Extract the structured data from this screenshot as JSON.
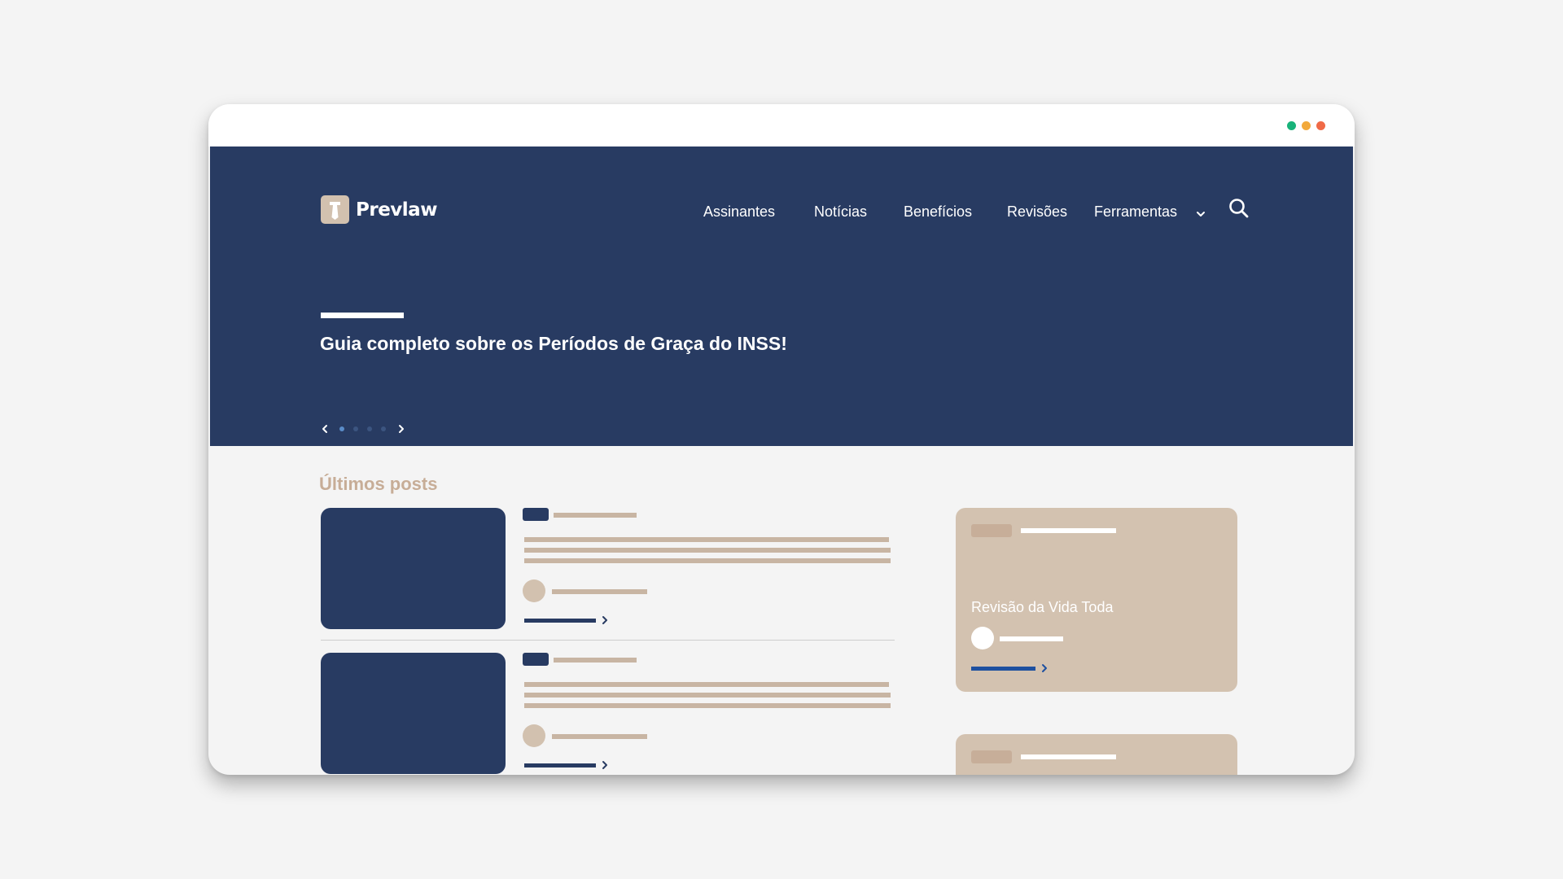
{
  "window": {
    "controls": [
      {
        "name": "green",
        "color": "#18b37a"
      },
      {
        "name": "yellow",
        "color": "#f2a93b"
      },
      {
        "name": "red",
        "color": "#f06a47"
      }
    ]
  },
  "colors": {
    "hero_bg": "#283b62",
    "accent_beige": "#d3c2b0",
    "section_title": "#c7ad97",
    "link_blue": "#1e50a0"
  },
  "header": {
    "logo_text": "Prevlaw",
    "nav": [
      {
        "label": "Assinantes"
      },
      {
        "label": "Notícias"
      },
      {
        "label": "Benefícios"
      },
      {
        "label": "Revisões"
      },
      {
        "label": "Ferramentas"
      }
    ],
    "search_icon": "search-icon",
    "dropdown_icon": "chevron-down-icon"
  },
  "hero": {
    "title": "Guia completo sobre os Períodos de Graça do INSS!",
    "slider": {
      "total": 4,
      "active": 1,
      "prev_icon": "chevron-left-icon",
      "next_icon": "chevron-right-icon"
    }
  },
  "main": {
    "section_title": "Últimos posts",
    "posts_visible": 2,
    "cards": [
      {
        "title": "Revisão da Vida Toda"
      },
      {
        "title": ""
      }
    ]
  }
}
